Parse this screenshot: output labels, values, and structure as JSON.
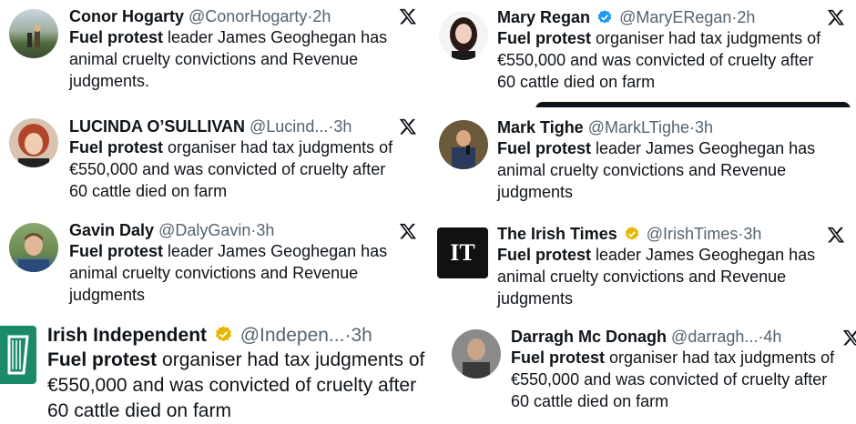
{
  "tweets": [
    {
      "name": "Conor Hogarty",
      "handle": "@ConorHogarty",
      "time": "2h",
      "bold": "Fuel protest",
      "l1": " leader James Geoghegan has",
      "l2": "animal cruelty convictions and Revenue",
      "l3": "judgments."
    },
    {
      "name": "LUCINDA O’SULLIVAN",
      "handle": "@Lucind...",
      "time": "3h",
      "bold": "Fuel protest",
      "l1": " organiser had tax judgments of",
      "l2": "€550,000 and was convicted of cruelty after",
      "l3": "60 cattle died on farm"
    },
    {
      "name": "Gavin Daly",
      "handle": "@DalyGavin",
      "time": "3h",
      "bold": "Fuel protest",
      "l1": " leader James Geoghegan has",
      "l2": "animal cruelty convictions and Revenue",
      "l3": "judgments"
    },
    {
      "name": "Irish Independent",
      "handle": "@Indepen...",
      "time": "3h",
      "bold": "Fuel protest",
      "l1": " organiser had tax judgments of",
      "l2": "€550,000 and was convicted of cruelty after",
      "l3": "60 cattle died on farm"
    },
    {
      "name": "Mary Regan",
      "handle": "@MaryERegan",
      "time": "2h",
      "bold": "Fuel protest",
      "l1": " organiser had tax judgments of",
      "l2": "€550,000 and was convicted of cruelty after",
      "l3": "60 cattle died on farm"
    },
    {
      "name": "Mark Tighe",
      "handle": "@MarkLTighe",
      "time": "3h",
      "bold": "Fuel protest",
      "l1": " leader James Geoghegan has",
      "l2": "animal cruelty convictions and Revenue",
      "l3": "judgments"
    },
    {
      "name": "The Irish Times",
      "handle": "@IrishTimes",
      "time": "3h",
      "bold": "Fuel protest",
      "l1": " leader James Geoghegan has",
      "l2": "animal cruelty convictions and Revenue",
      "l3": "judgments"
    },
    {
      "name": "Darragh Mc Donagh",
      "handle": "@darragh...",
      "time": "4h",
      "bold": "Fuel protest",
      "l1": " organiser had tax judgments of",
      "l2": "€550,000 and was convicted of cruelty after",
      "l3": "60 cattle died on farm"
    }
  ],
  "logos": {
    "irish_times": "IT"
  },
  "separator": "·",
  "colors": {
    "text": "#0f1419",
    "muted": "#536471",
    "verified_gold": "#e8b500"
  },
  "icons": {
    "x": "x-logo-icon",
    "verified": "verified-badge-icon"
  }
}
